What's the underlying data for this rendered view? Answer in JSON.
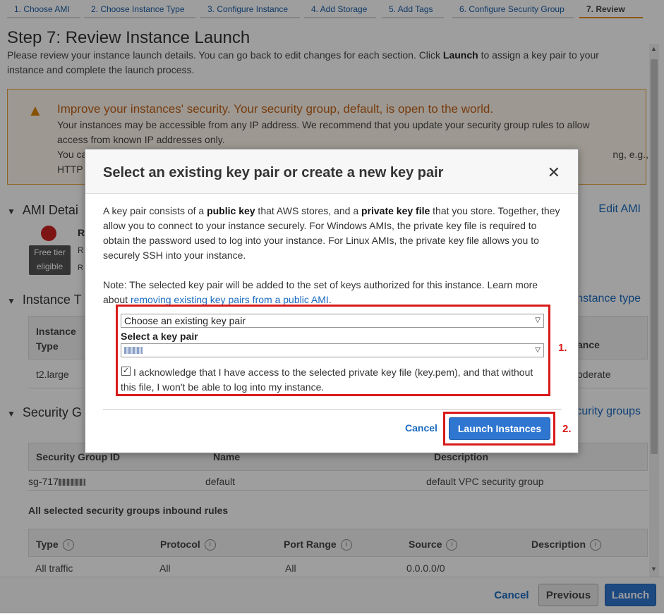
{
  "wizard": {
    "steps": [
      {
        "label": "1. Choose AMI"
      },
      {
        "label": "2. Choose Instance Type"
      },
      {
        "label": "3. Configure Instance"
      },
      {
        "label": "4. Add Storage"
      },
      {
        "label": "5. Add Tags"
      },
      {
        "label": "6. Configure Security Group"
      },
      {
        "label": "7. Review"
      }
    ],
    "title": "Step 7: Review Instance Launch",
    "intro_before": "Please review your instance launch details. You can go back to edit changes for each section. Click ",
    "intro_bold": "Launch",
    "intro_after": " to assign a key pair to your instance and complete the launch process."
  },
  "warning": {
    "title": "Improve your instances' security. Your security group, default, is open to the world.",
    "line1": "Your instances may be accessible from any IP address. We recommend that you update your security group rules to allow access from known IP addresses only.",
    "line2_start": "You ca",
    "line2_end": "ng, e.g.,",
    "line3": "HTTP"
  },
  "ami_section": {
    "title": "AMI Detai",
    "edit": "Edit AMI",
    "name_start": "R",
    "free_tier_line1": "Free tier",
    "free_tier_line2": "eligible",
    "row2": "R",
    "row3": "R"
  },
  "instance_section": {
    "title": "Instance T",
    "edit": "nstance type",
    "col_instance": "Instance",
    "col_type": "Type",
    "col_right": "ance",
    "value_type": "t2.large",
    "value_right": "oderate"
  },
  "security_section": {
    "title": "Security G",
    "edit": "curity groups",
    "headers": [
      "Security Group ID",
      "Name",
      "Description"
    ],
    "row": {
      "id_prefix": "sg-717",
      "name": "default",
      "description": "default VPC security group"
    },
    "inbound_title": "All selected security groups inbound rules",
    "rule_headers": [
      "Type",
      "Protocol",
      "Port Range",
      "Source",
      "Description"
    ],
    "rule_row": [
      "All traffic",
      "All",
      "All",
      "0.0.0.0/0"
    ]
  },
  "footer": {
    "cancel": "Cancel",
    "previous": "Previous",
    "launch": "Launch"
  },
  "modal": {
    "title": "Select an existing key pair or create a new key pair",
    "close": "✕",
    "p1_a": "A key pair consists of a ",
    "p1_b": "public key",
    "p1_c": " that AWS stores, and a ",
    "p1_d": "private key file",
    "p1_e": " that you store. Together, they allow you to connect to your instance securely. For Windows AMIs, the private key file is required to obtain the password used to log into your instance. For Linux AMIs, the private key file allows you to securely SSH into your instance.",
    "note_a": "Note: The selected key pair will be added to the set of keys authorized for this instance. Learn more about ",
    "note_link": "removing existing key pairs from a public AMI",
    "note_b": ".",
    "mode_select": "Choose an existing key pair",
    "key_label": "Select a key pair",
    "checkbox_mark": "✓",
    "ack": "I acknowledge that I have access to the selected private key file (key.pem), and that without this file, I won't be able to log into my instance.",
    "cancel": "Cancel",
    "launch": "Launch Instances"
  },
  "annotations": {
    "step1": "1.",
    "step2": "2."
  },
  "colors": {
    "accent_blue": "#2f76d1",
    "annotation_red": "#d91a1a",
    "warning_orange": "#c0621a"
  }
}
